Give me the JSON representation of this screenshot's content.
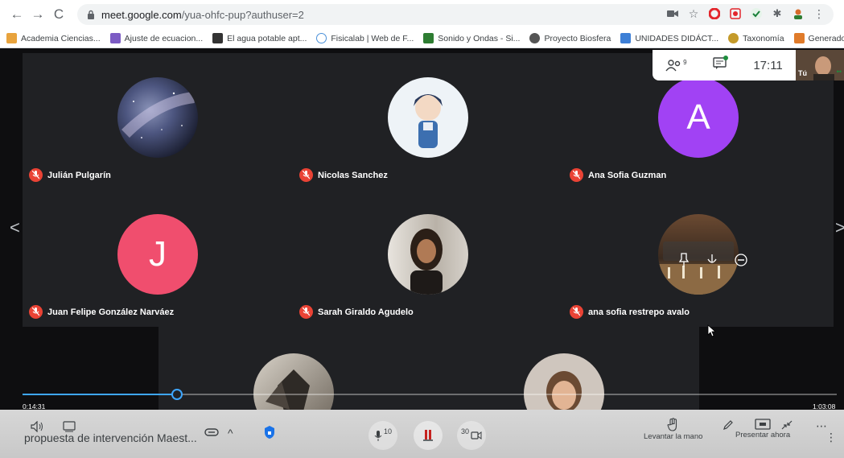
{
  "browser": {
    "url_host": "meet.google.com",
    "url_path": "/yua-ohfc-pup?authuser=2",
    "bookmarks": [
      {
        "label": "Academia Ciencias...",
        "color": "#e8a33d"
      },
      {
        "label": "Ajuste de ecuacion...",
        "color": "#7c5cc4"
      },
      {
        "label": "El agua potable apt...",
        "color": "#333333"
      },
      {
        "label": "Fisicalab | Web de F...",
        "color": "#4a90d9"
      },
      {
        "label": "Sonido y Ondas - Si...",
        "color": "#2e7d32"
      },
      {
        "label": "Proyecto Biosfera",
        "color": "#555555"
      },
      {
        "label": "UNIDADES DIDÁCT...",
        "color": "#3d7fd6"
      },
      {
        "label": "Taxonomía",
        "color": "#c49a2a"
      },
      {
        "label": "Generador de Cruci...",
        "color": "#e07b2a"
      }
    ],
    "more_bookmarks": "»"
  },
  "meet": {
    "participants_count": "9",
    "time": "17:11",
    "self_label": "Tú",
    "participants": [
      {
        "name": "Julián Pulgarín",
        "type": "galaxy"
      },
      {
        "name": "Nicolas Sanchez",
        "type": "anime"
      },
      {
        "name": "Ana Sofia Guzman",
        "initial": "A",
        "color": "#a142f4"
      },
      {
        "name": "Juan Felipe González Narváez",
        "initial": "J",
        "color": "#f04e6e"
      },
      {
        "name": "Sarah Giraldo Agudelo",
        "type": "photo"
      },
      {
        "name": "ana sofia restrepo avalo",
        "type": "photo-dark"
      }
    ]
  },
  "player": {
    "current_time": "0:14:31",
    "total_time": "1:03:08",
    "progress": 0.19,
    "file_title": "propuesta de intervención Maest...",
    "rewind_label": "10",
    "forward_label": "30",
    "raise_hand_label": "Levantar la mano",
    "present_label": "Presentar ahora"
  },
  "colors": {
    "accent": "#3ea6ff",
    "mic_off": "#ea4335"
  }
}
